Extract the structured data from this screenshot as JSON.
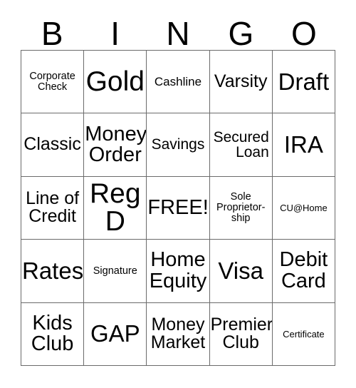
{
  "card": {
    "header_letters": [
      "B",
      "I",
      "N",
      "G",
      "O"
    ],
    "rows": [
      [
        {
          "text": "Corporate\nCheck",
          "size": "fs-xxs",
          "align": "center"
        },
        {
          "text": "Gold",
          "size": "fs-xxl",
          "align": "center"
        },
        {
          "text": "Cashline",
          "size": "fs-xs",
          "align": "center"
        },
        {
          "text": "Varsity",
          "size": "fs-md",
          "align": "center"
        },
        {
          "text": "Draft",
          "size": "fs-xl",
          "align": "center"
        }
      ],
      [
        {
          "text": "Classic",
          "size": "fs-md",
          "align": "center"
        },
        {
          "text": "Money\nOrder",
          "size": "fs-lg",
          "align": "center"
        },
        {
          "text": "Savings",
          "size": "fs-sm",
          "align": "center"
        },
        {
          "text": "Secured\nLoan",
          "size": "fs-sm",
          "align": "right"
        },
        {
          "text": "IRA",
          "size": "fs-xl",
          "align": "center"
        }
      ],
      [
        {
          "text": "Line of\nCredit",
          "size": "fs-md",
          "align": "center"
        },
        {
          "text": "Reg\nD",
          "size": "fs-xxl",
          "align": "center"
        },
        {
          "text": "FREE!",
          "size": "fs-lg",
          "align": "center"
        },
        {
          "text": "Sole\nProprietor-\nship",
          "size": "fs-xxs",
          "align": "center"
        },
        {
          "text": "CU@Home",
          "size": "fs-tiny",
          "align": "center"
        }
      ],
      [
        {
          "text": "Rates",
          "size": "fs-xl",
          "align": "center"
        },
        {
          "text": "Signature",
          "size": "fs-xxs",
          "align": "center"
        },
        {
          "text": "Home\nEquity",
          "size": "fs-lg",
          "align": "center"
        },
        {
          "text": "Visa",
          "size": "fs-xl",
          "align": "center"
        },
        {
          "text": "Debit\nCard",
          "size": "fs-lg",
          "align": "center"
        }
      ],
      [
        {
          "text": "Kids\nClub",
          "size": "fs-lg",
          "align": "center"
        },
        {
          "text": "GAP",
          "size": "fs-xl",
          "align": "center"
        },
        {
          "text": "Money\nMarket",
          "size": "fs-md",
          "align": "center"
        },
        {
          "text": "Premier\nClub",
          "size": "fs-md",
          "align": "center"
        },
        {
          "text": "Certificate",
          "size": "fs-tiny",
          "align": "center"
        }
      ]
    ],
    "colors": {
      "grid_line": "#6b6b6b",
      "text": "#000000",
      "background": "#ffffff"
    },
    "free_space": "FREE!"
  }
}
